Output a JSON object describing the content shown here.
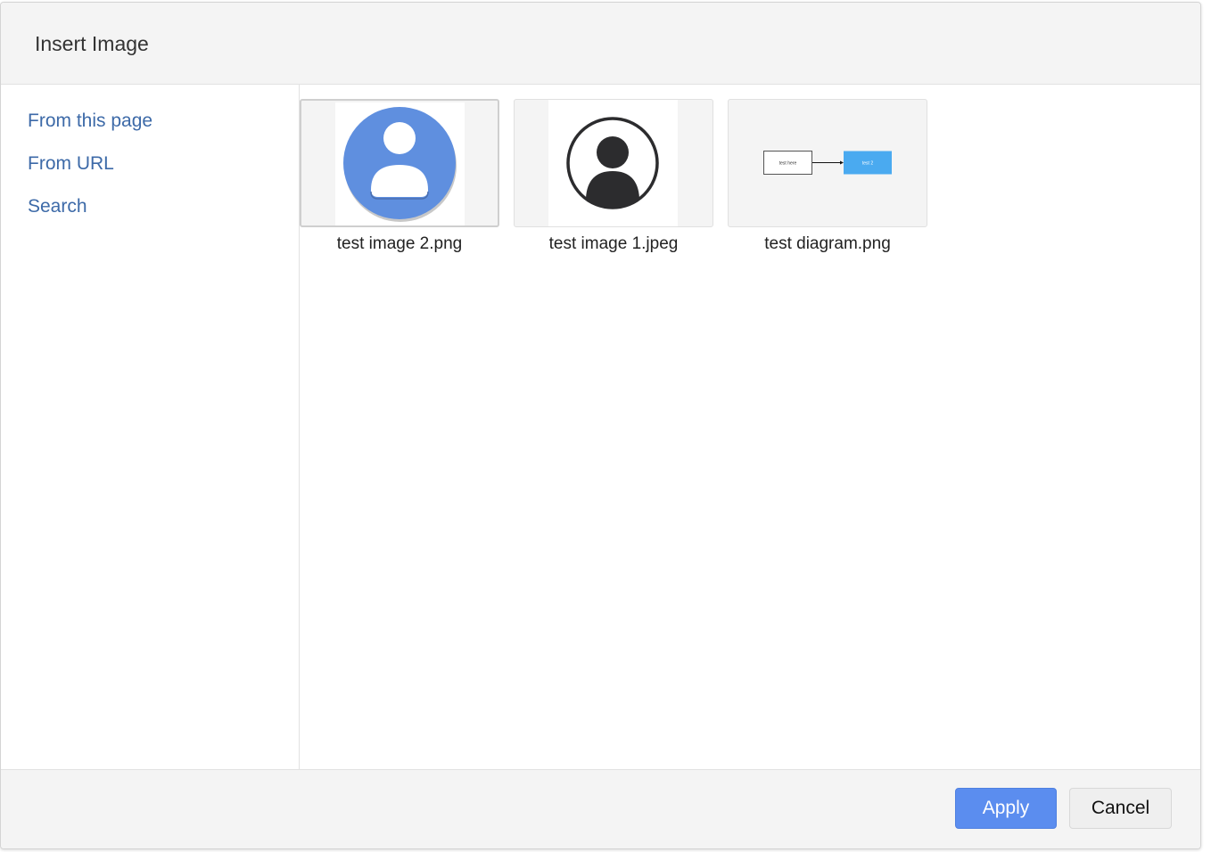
{
  "dialog": {
    "title": "Insert Image"
  },
  "sidebar": {
    "items": [
      {
        "label": "From this page"
      },
      {
        "label": "From URL"
      },
      {
        "label": "Search"
      }
    ]
  },
  "gallery": {
    "images": [
      {
        "name": "test image 2.png",
        "selected": true,
        "icon": "user-avatar-blue-icon"
      },
      {
        "name": "test image 1.jpeg",
        "selected": false,
        "icon": "user-circle-outline-icon"
      },
      {
        "name": "test diagram.png",
        "selected": false,
        "icon": "diagram-thumbnail"
      }
    ],
    "diagram": {
      "box1_text": "test here",
      "box2_text": "test 2"
    }
  },
  "footer": {
    "apply_label": "Apply",
    "cancel_label": "Cancel"
  },
  "colors": {
    "accent": "#5b8def",
    "link": "#3d6aa8",
    "avatar_blue": "#5f8fdf",
    "diagram_blue": "#4aaaf0"
  }
}
